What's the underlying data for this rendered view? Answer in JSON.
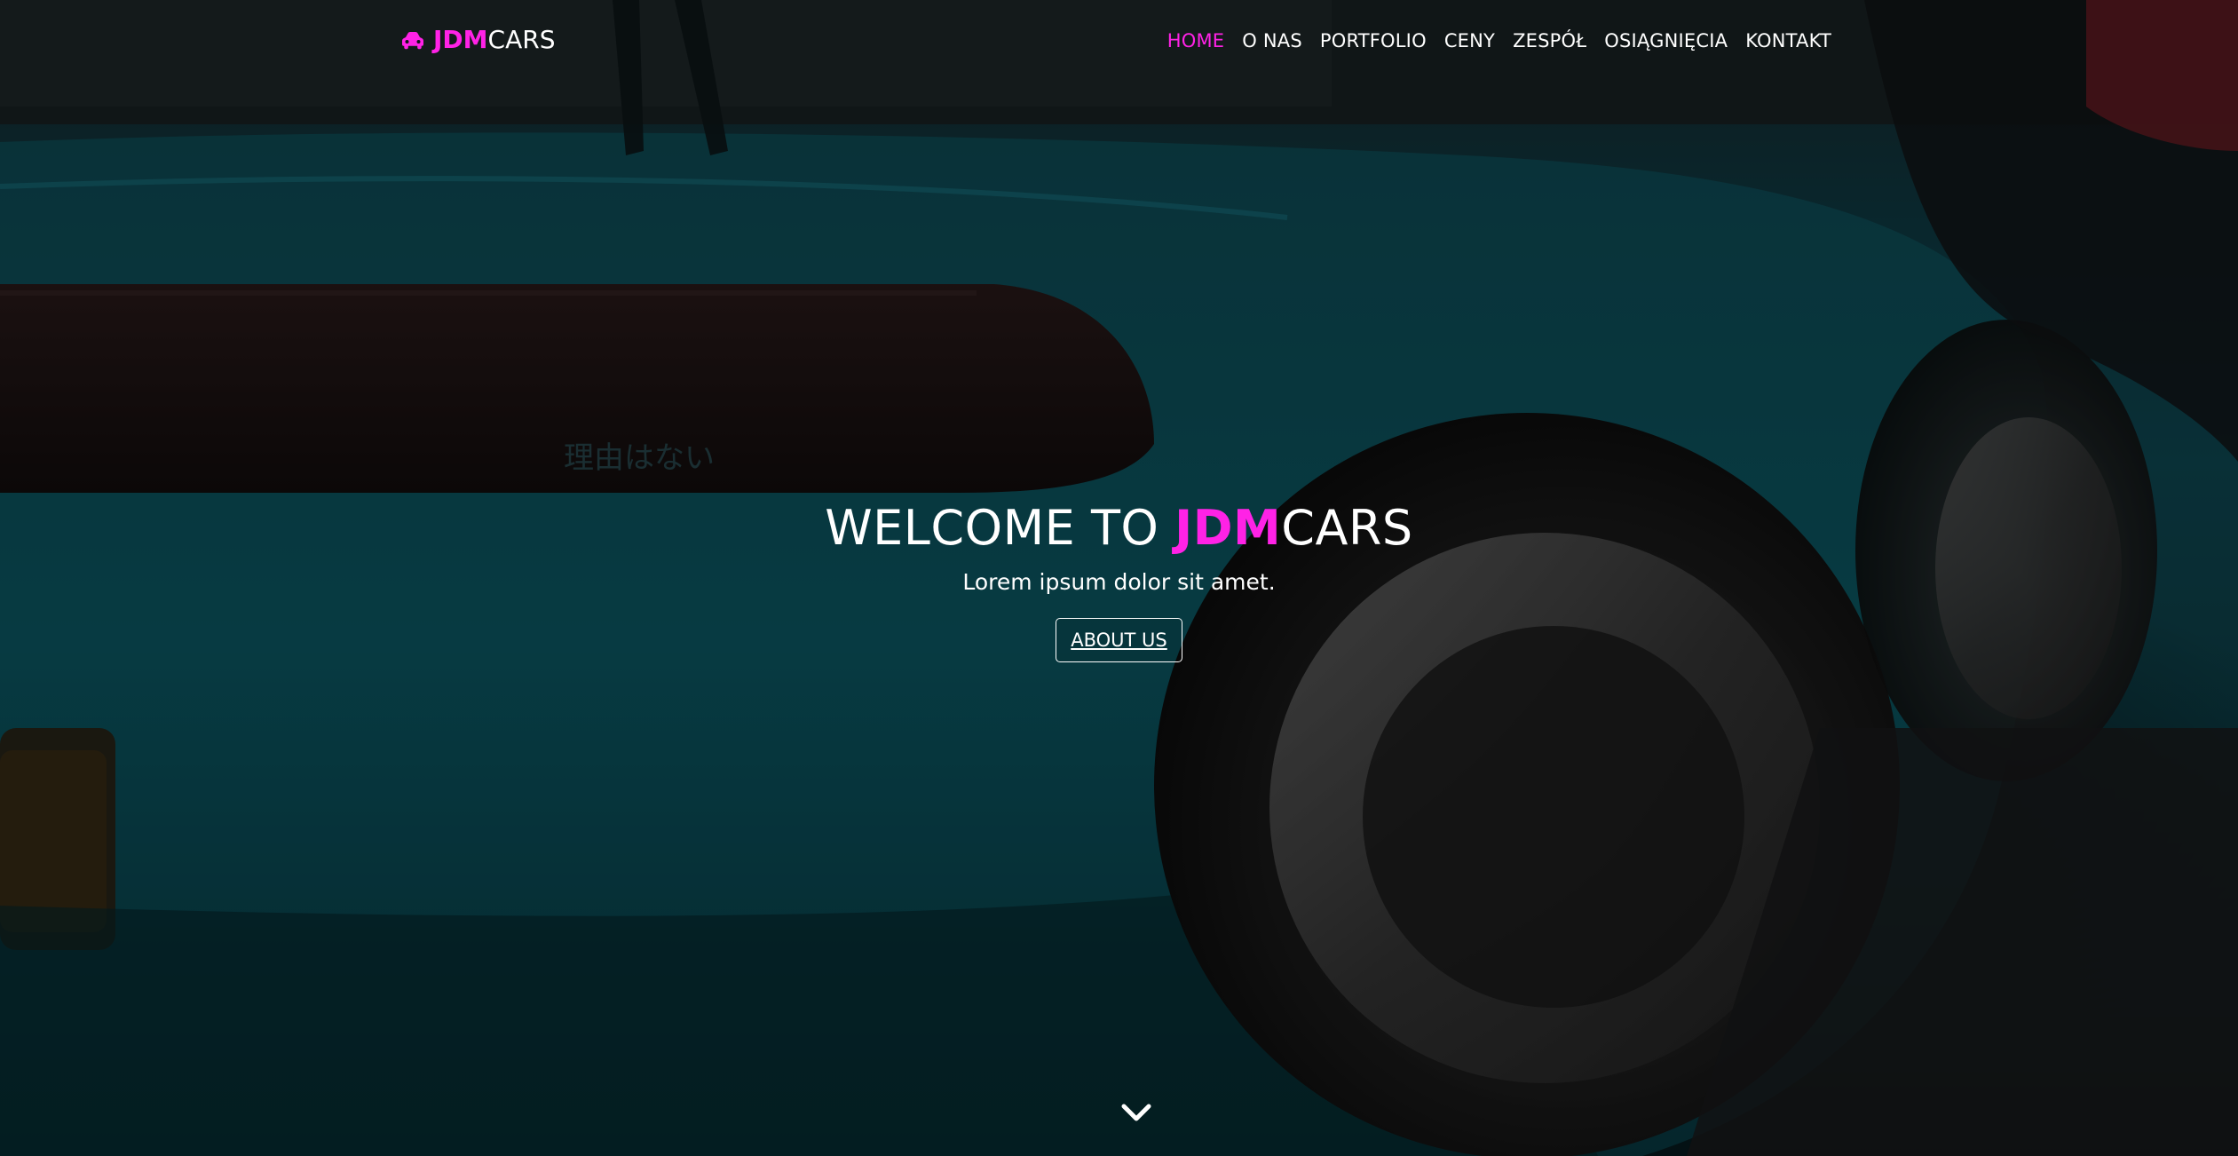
{
  "brand": {
    "jdm": "JDM",
    "cars": "CARS",
    "accent": "#ff22e6",
    "icon": "car-icon"
  },
  "nav": {
    "items": [
      {
        "label": "HOME",
        "active": true
      },
      {
        "label": "O NAS"
      },
      {
        "label": "PORTFOLIO"
      },
      {
        "label": "CENY"
      },
      {
        "label": "ZESPÓŁ"
      },
      {
        "label": "OSIĄGNIĘCIA"
      },
      {
        "label": "KONTAKT"
      }
    ]
  },
  "hero": {
    "title_prefix": "WELCOME TO ",
    "title_jdm": "JDM",
    "title_cars": "CARS",
    "subtitle": "Lorem ipsum dolor sit amet.",
    "button": "ABOUT US",
    "scroll_icon": "chevron-down-icon",
    "background_text": "理由はない"
  }
}
